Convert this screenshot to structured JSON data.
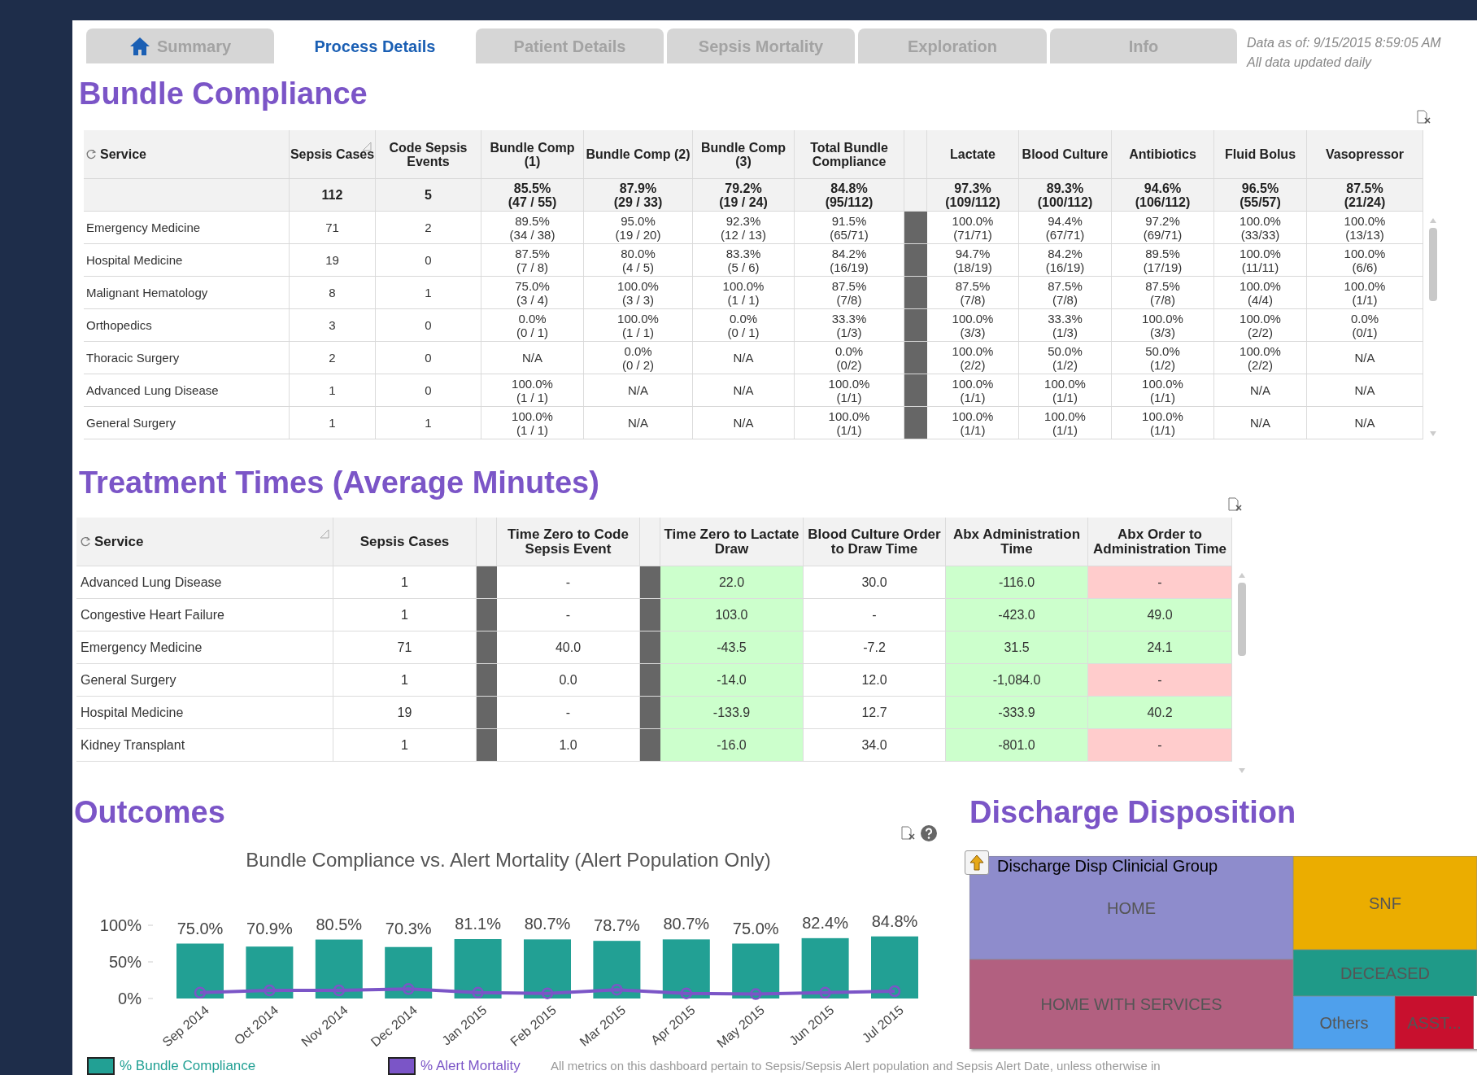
{
  "tabs": [
    {
      "label": "Summary",
      "selected": false
    },
    {
      "label": "Process Details",
      "selected": true
    },
    {
      "label": "Patient Details",
      "selected": false
    },
    {
      "label": "Sepsis Mortality",
      "selected": false
    },
    {
      "label": "Exploration",
      "selected": false
    },
    {
      "label": "Info",
      "selected": false
    }
  ],
  "data_as_of": "Data as of: 9/15/2015 8:59:05 AM",
  "update_note": "All data updated daily",
  "bundle_compliance": {
    "title": "Bundle Compliance",
    "columns": [
      "Service",
      "Sepsis Cases",
      "Code Sepsis Events",
      "Bundle Comp (1)",
      "Bundle Comp (2)",
      "Bundle Comp (3)",
      "Total Bundle Compliance",
      "Lactate",
      "Blood Culture",
      "Antibiotics",
      "Fluid Bolus",
      "Vasopressor"
    ],
    "totals": [
      "112",
      "5",
      "85.5%\n(47 / 55)",
      "87.9%\n(29 / 33)",
      "79.2%\n(19 / 24)",
      "84.8%\n(95/112)",
      "97.3%\n(109/112)",
      "89.3%\n(100/112)",
      "94.6%\n(106/112)",
      "96.5%\n(55/57)",
      "87.5%\n(21/24)"
    ],
    "rows": [
      [
        "Emergency Medicine",
        "71",
        "2",
        "89.5%\n(34 / 38)",
        "95.0%\n(19 / 20)",
        "92.3%\n(12 / 13)",
        "91.5%\n(65/71)",
        "100.0%\n(71/71)",
        "94.4%\n(67/71)",
        "97.2%\n(69/71)",
        "100.0%\n(33/33)",
        "100.0%\n(13/13)"
      ],
      [
        "Hospital Medicine",
        "19",
        "0",
        "87.5%\n(7 / 8)",
        "80.0%\n(4 / 5)",
        "83.3%\n(5 / 6)",
        "84.2%\n(16/19)",
        "94.7%\n(18/19)",
        "84.2%\n(16/19)",
        "89.5%\n(17/19)",
        "100.0%\n(11/11)",
        "100.0%\n(6/6)"
      ],
      [
        "Malignant Hematology",
        "8",
        "1",
        "75.0%\n(3 / 4)",
        "100.0%\n(3 / 3)",
        "100.0%\n(1 / 1)",
        "87.5%\n(7/8)",
        "87.5%\n(7/8)",
        "87.5%\n(7/8)",
        "87.5%\n(7/8)",
        "100.0%\n(4/4)",
        "100.0%\n(1/1)"
      ],
      [
        "Orthopedics",
        "3",
        "0",
        "0.0%\n(0 / 1)",
        "100.0%\n(1 / 1)",
        "0.0%\n(0 / 1)",
        "33.3%\n(1/3)",
        "100.0%\n(3/3)",
        "33.3%\n(1/3)",
        "100.0%\n(3/3)",
        "100.0%\n(2/2)",
        "0.0%\n(0/1)"
      ],
      [
        "Thoracic Surgery",
        "2",
        "0",
        "N/A",
        "0.0%\n(0 / 2)",
        "N/A",
        "0.0%\n(0/2)",
        "100.0%\n(2/2)",
        "50.0%\n(1/2)",
        "50.0%\n(1/2)",
        "100.0%\n(2/2)",
        "N/A"
      ],
      [
        "Advanced Lung Disease",
        "1",
        "0",
        "100.0%\n(1 / 1)",
        "N/A",
        "N/A",
        "100.0%\n(1/1)",
        "100.0%\n(1/1)",
        "100.0%\n(1/1)",
        "100.0%\n(1/1)",
        "N/A",
        "N/A"
      ],
      [
        "General Surgery",
        "1",
        "1",
        "100.0%\n(1 / 1)",
        "N/A",
        "N/A",
        "100.0%\n(1/1)",
        "100.0%\n(1/1)",
        "100.0%\n(1/1)",
        "100.0%\n(1/1)",
        "N/A",
        "N/A"
      ]
    ]
  },
  "treatment_times": {
    "title": "Treatment Times (Average Minutes)",
    "columns": [
      "Service",
      "Sepsis Cases",
      "Time Zero to Code Sepsis Event",
      "Time Zero to Lactate Draw",
      "Blood Culture Order to Draw Time",
      "Abx Administration Time",
      "Abx Order to Administration Time"
    ],
    "rows": [
      [
        "Advanced Lung Disease",
        "1",
        "-",
        {
          "text": "22.0",
          "color": "#ccffcc"
        },
        "30.0",
        {
          "text": "-116.0",
          "color": "#ccffcc"
        },
        {
          "text": "-",
          "color": "#ffcccc"
        }
      ],
      [
        "Congestive Heart Failure",
        "1",
        "-",
        {
          "text": "103.0",
          "color": "#ccffcc"
        },
        "-",
        {
          "text": "-423.0",
          "color": "#ccffcc"
        },
        {
          "text": "49.0",
          "color": "#ccffcc"
        }
      ],
      [
        "Emergency Medicine",
        "71",
        "40.0",
        {
          "text": "-43.5",
          "color": "#ccffcc"
        },
        "-7.2",
        {
          "text": "31.5",
          "color": "#ccffcc"
        },
        {
          "text": "24.1",
          "color": "#ccffcc"
        }
      ],
      [
        "General Surgery",
        "1",
        "0.0",
        {
          "text": "-14.0",
          "color": "#ccffcc"
        },
        "12.0",
        {
          "text": "-1,084.0",
          "color": "#ccffcc"
        },
        {
          "text": "-",
          "color": "#ffcccc"
        }
      ],
      [
        "Hospital Medicine",
        "19",
        "-",
        {
          "text": "-133.9",
          "color": "#ccffcc"
        },
        "12.7",
        {
          "text": "-333.9",
          "color": "#ccffcc"
        },
        {
          "text": "40.2",
          "color": "#ccffcc"
        }
      ],
      [
        "Kidney Transplant",
        "1",
        "1.0",
        {
          "text": "-16.0",
          "color": "#ccffcc"
        },
        "34.0",
        {
          "text": "-801.0",
          "color": "#ccffcc"
        },
        {
          "text": "-",
          "color": "#ffcccc"
        }
      ]
    ]
  },
  "outcomes": {
    "title": "Outcomes",
    "chart_data": {
      "type": "bar",
      "title": "Bundle Compliance vs. Alert Mortality (Alert Population Only)",
      "categories": [
        "Sep 2014",
        "Oct 2014",
        "Nov 2014",
        "Dec 2014",
        "Jan 2015",
        "Feb 2015",
        "Mar 2015",
        "Apr 2015",
        "May 2015",
        "Jun 2015",
        "Jul 2015"
      ],
      "series": [
        {
          "name": "% Bundle Compliance",
          "color": "#22a094",
          "type": "bar",
          "values": [
            75.0,
            70.9,
            80.5,
            70.3,
            81.1,
            80.7,
            78.7,
            80.7,
            75.0,
            82.4,
            84.8
          ]
        },
        {
          "name": "% Alert Mortality",
          "color": "#7b55c7",
          "type": "line",
          "marker": "circle",
          "values": [
            8,
            11,
            11,
            13,
            8,
            7,
            12,
            7,
            6,
            8,
            10
          ]
        }
      ],
      "ylim": [
        0,
        100
      ],
      "yticks": [
        {
          "value": 0,
          "label": "0%"
        },
        {
          "value": 50,
          "label": "50%"
        },
        {
          "value": 100,
          "label": "100%"
        }
      ],
      "value_labels": [
        "75.0%",
        "70.9%",
        "80.5%",
        "70.3%",
        "81.1%",
        "80.7%",
        "78.7%",
        "80.7%",
        "75.0%",
        "82.4%",
        "84.8%"
      ]
    },
    "footnote": "All metrics on this dashboard  pertain to Sepsis/Sepsis Alert population and Sepsis Alert Date, unless otherwise in"
  },
  "discharge": {
    "title": "Discharge Disposition",
    "group_label": "Discharge Disp Clinicial Group",
    "tiles": [
      {
        "label": "HOME",
        "color": "#8e8ccc"
      },
      {
        "label": "HOME WITH SERVICES",
        "color": "#b26080"
      },
      {
        "label": "SNF",
        "color": "#ebad00"
      },
      {
        "label": "DECEASED",
        "color": "#1f9a88"
      },
      {
        "label": "Others",
        "color": "#4fa0ec"
      },
      {
        "label": "ASST...",
        "color": "#c8102e"
      }
    ]
  }
}
